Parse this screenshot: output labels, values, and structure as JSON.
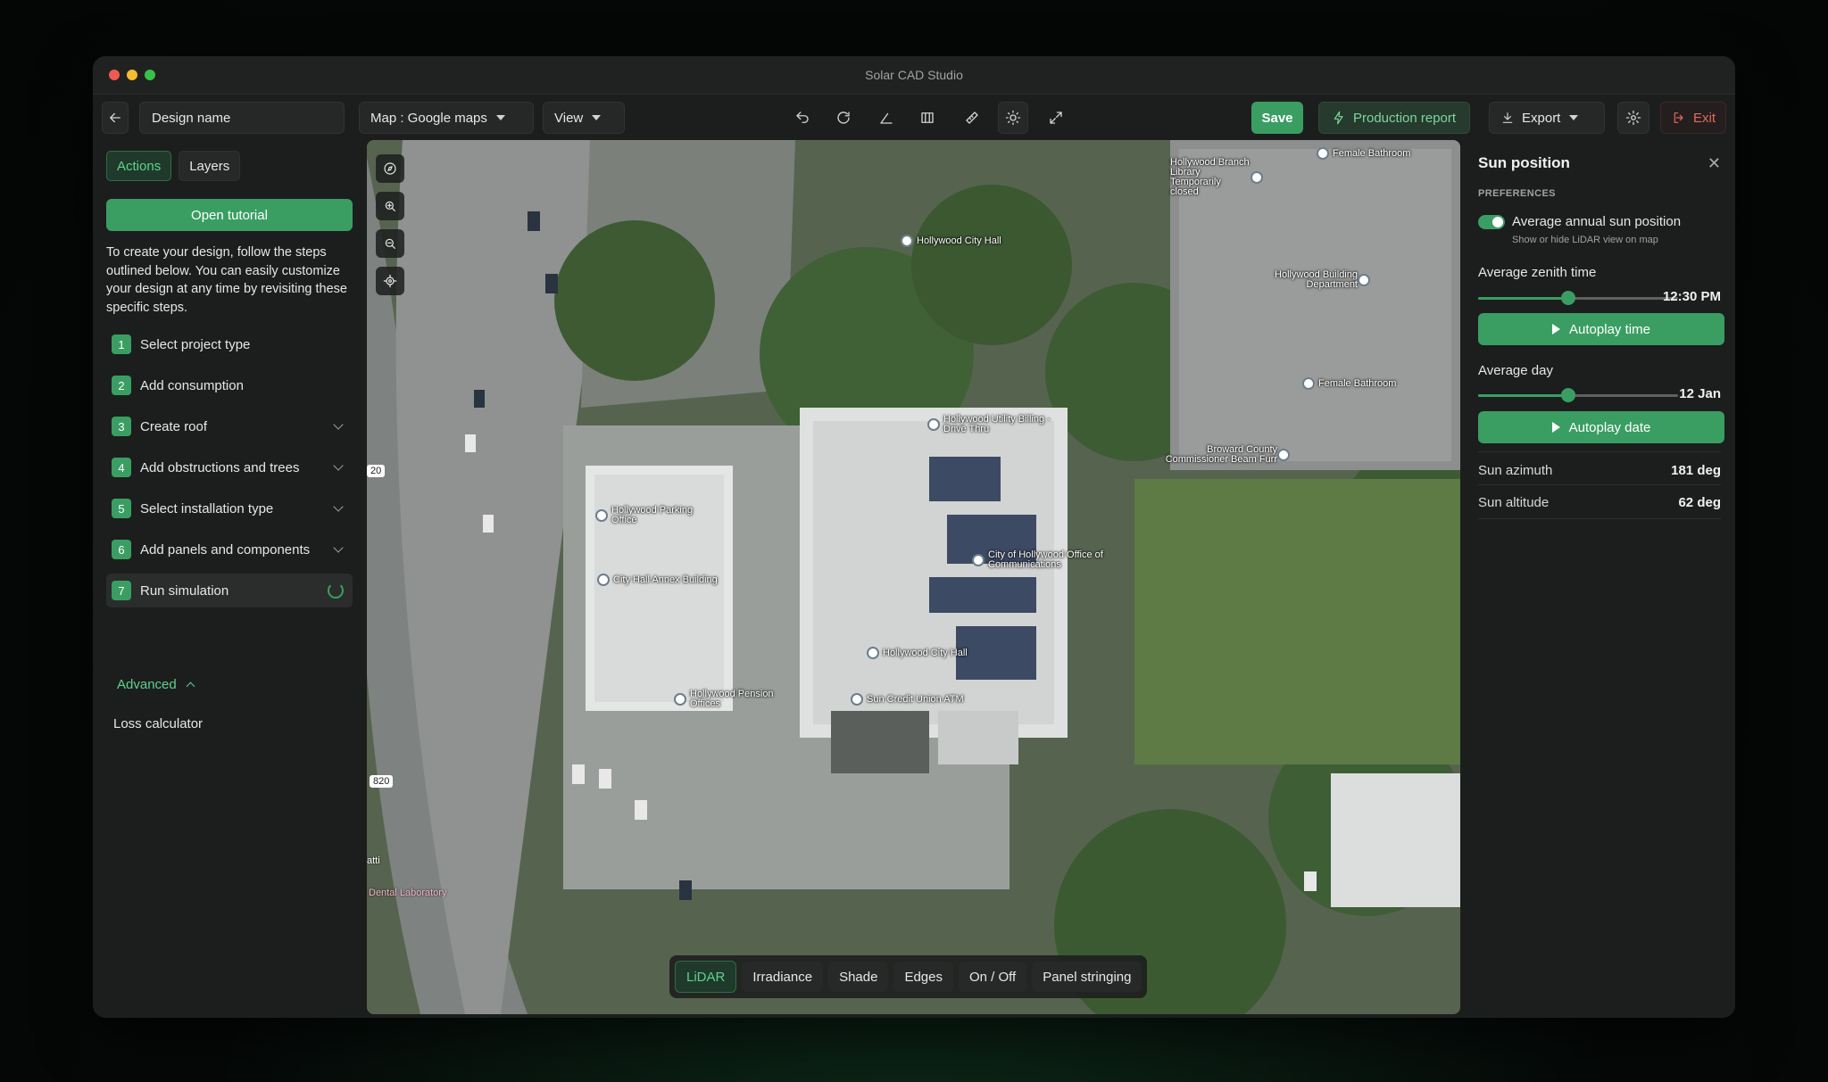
{
  "window": {
    "title": "Solar CAD Studio"
  },
  "toolbar": {
    "design_name": "Design name",
    "map_label": "Map : Google maps",
    "view_label": "View",
    "save_label": "Save",
    "production_label": "Production report",
    "export_label": "Export",
    "exit_label": "Exit"
  },
  "left": {
    "tabs": [
      "Actions",
      "Layers"
    ],
    "open_tutorial": "Open tutorial",
    "intro": "To create your design, follow the steps outlined below. You can easily customize your design at any time by revisiting these specific steps.",
    "steps": [
      {
        "num": "1",
        "label": "Select project type"
      },
      {
        "num": "2",
        "label": "Add consumption"
      },
      {
        "num": "3",
        "label": "Create roof"
      },
      {
        "num": "4",
        "label": "Add obstructions and trees"
      },
      {
        "num": "5",
        "label": "Select installation type"
      },
      {
        "num": "6",
        "label": "Add panels and components"
      },
      {
        "num": "7",
        "label": "Run simulation"
      }
    ],
    "advanced": "Advanced",
    "loss_calculator": "Loss calculator"
  },
  "map": {
    "pois": [
      "Hollywood Branch Library Temporarily closed",
      "Female Bathroom",
      "Hollywood City Hall",
      "Hollywood Building Department",
      "Female Bathroom",
      "Hollywood Utility Billing - Drive Thru",
      "Broward County Commissioner Beam Furr",
      "Hollywood Parking Office",
      "City Hall Annex Building",
      "City of Hollywood Office of Communications",
      "Hollywood City Hall",
      "Hollywood Pension Offices",
      "Sun Credit Union ATM"
    ],
    "road_labels": [
      "20",
      "820",
      "atti",
      "Dental Laboratory"
    ],
    "layer_buttons": [
      "LiDAR",
      "Irradiance",
      "Shade",
      "Edges",
      "On / Off",
      "Panel stringing"
    ],
    "active_layer": "LiDAR"
  },
  "sun_panel": {
    "title": "Sun position",
    "section": "PREFERENCES",
    "toggle_label": "Average annual sun position",
    "toggle_sub": "Show or hide LiDAR view on map",
    "toggle_on": true,
    "zenith_label": "Average zenith time",
    "zenith_value": "12:30 PM",
    "zenith_fraction": 0.45,
    "autoplay_time": "Autoplay time",
    "day_label": "Average day",
    "day_value": "12 Jan",
    "day_fraction": 0.45,
    "autoplay_date": "Autoplay date",
    "azimuth_label": "Sun azimuth",
    "azimuth_value": "181 deg",
    "altitude_label": "Sun altitude",
    "altitude_value": "62 deg"
  },
  "colors": {
    "accent": "#3a9e63",
    "accent_text": "#5fd18e",
    "exit": "#e36a5c"
  }
}
